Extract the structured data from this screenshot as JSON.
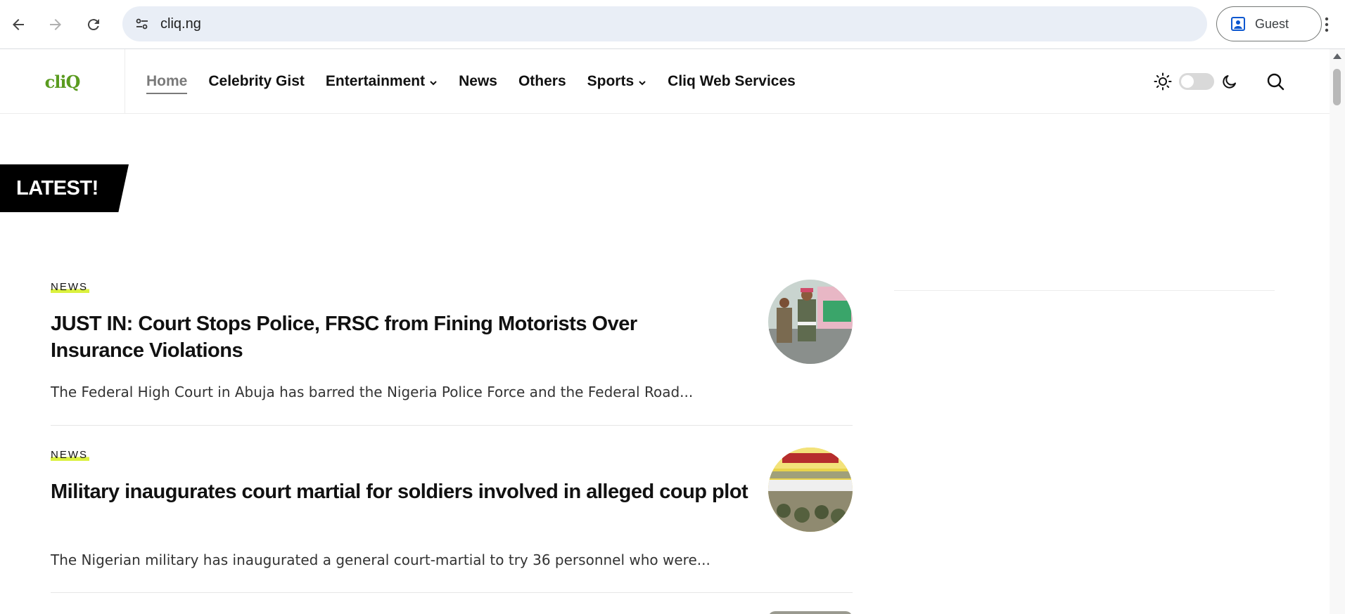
{
  "browser": {
    "url": "cliq.ng",
    "profile_label": "Guest"
  },
  "site": {
    "logo_text": "cliQ",
    "nav": [
      {
        "label": "Home",
        "active": true,
        "has_dropdown": false
      },
      {
        "label": "Celebrity Gist",
        "active": false,
        "has_dropdown": false
      },
      {
        "label": "Entertainment",
        "active": false,
        "has_dropdown": true
      },
      {
        "label": "News",
        "active": false,
        "has_dropdown": false
      },
      {
        "label": "Others",
        "active": false,
        "has_dropdown": false
      },
      {
        "label": "Sports",
        "active": false,
        "has_dropdown": true
      },
      {
        "label": "Cliq Web Services",
        "active": false,
        "has_dropdown": false
      }
    ],
    "tools": {
      "theme_toggle": "off",
      "icons": [
        "sun-icon",
        "moon-icon",
        "search-icon"
      ]
    }
  },
  "section": {
    "badge": "LATEST!"
  },
  "articles": [
    {
      "category": "NEWS",
      "headline": "JUST IN: Court Stops Police, FRSC from Fining Motorists Over Insurance Violations",
      "excerpt": "The Federal High Court in Abuja has barred the Nigeria Police Force and the Federal Road..."
    },
    {
      "category": "NEWS",
      "headline": "Military inaugurates court martial for soldiers involved in alleged coup plot",
      "excerpt": "The Nigerian military has inaugurated a general court-martial to try 36 personnel who were..."
    }
  ],
  "colors": {
    "accent_highlight": "#dbf13f",
    "logo_green": "#5a9b1f",
    "badge_bg": "#000000"
  }
}
